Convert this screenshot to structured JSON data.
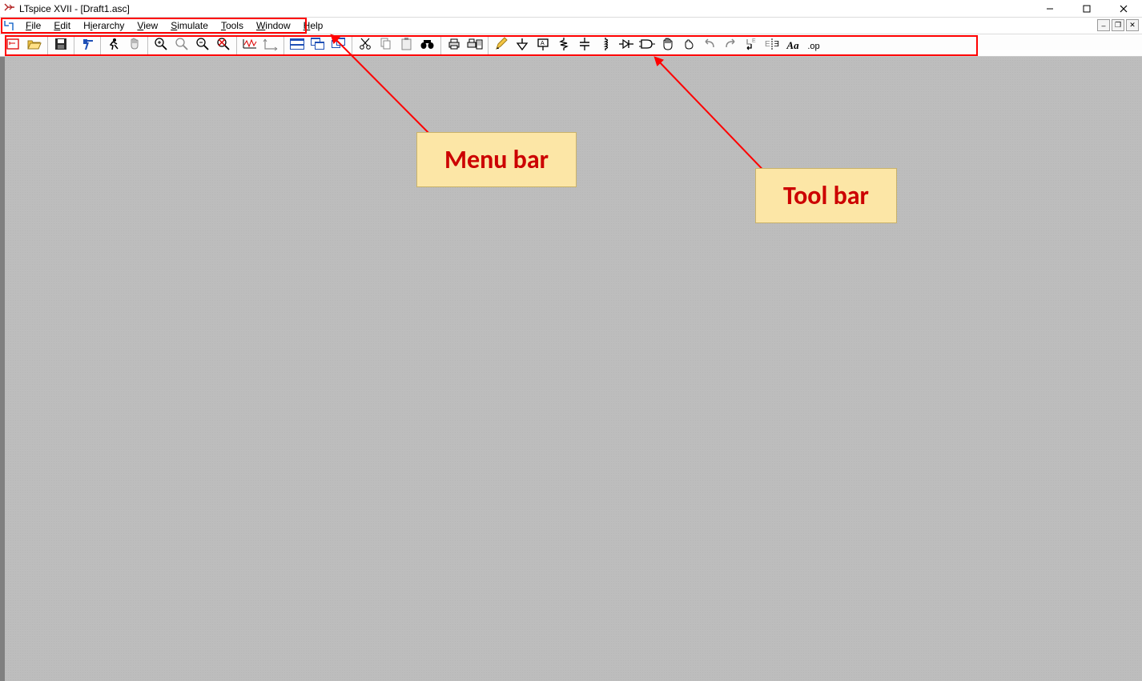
{
  "title": "LTspice XVII - [Draft1.asc]",
  "menu": {
    "items": [
      "File",
      "Edit",
      "Hierarchy",
      "View",
      "Simulate",
      "Tools",
      "Window",
      "Help"
    ]
  },
  "toolbar": {
    "groups": [
      [
        "new-schematic",
        "open",
        "save"
      ],
      [
        "control-panel"
      ],
      [
        "run",
        "halt"
      ],
      [
        "zoom-in",
        "pan",
        "zoom-out",
        "zoom-fit"
      ],
      [
        "autorange",
        "pick-traces"
      ],
      [
        "tile-windows",
        "cascade-windows",
        "close-all-windows"
      ],
      [
        "cut",
        "copy",
        "paste",
        "find",
        "search"
      ],
      [
        "print",
        "print-setup"
      ],
      [
        "draw-wire",
        "ground",
        "label-net",
        "resistor",
        "capacitor",
        "inductor",
        "diode",
        "component",
        "move",
        "drag",
        "undo",
        "redo",
        "rotate",
        "mirror",
        "place-comment",
        "text",
        "spice-directive"
      ]
    ]
  },
  "annotations": {
    "menu_label": "Menu bar",
    "tool_label": "Tool bar"
  },
  "colors": {
    "red_annotation": "#ff0000",
    "callout_bg": "#fce6a6",
    "callout_text": "#cc0000"
  }
}
